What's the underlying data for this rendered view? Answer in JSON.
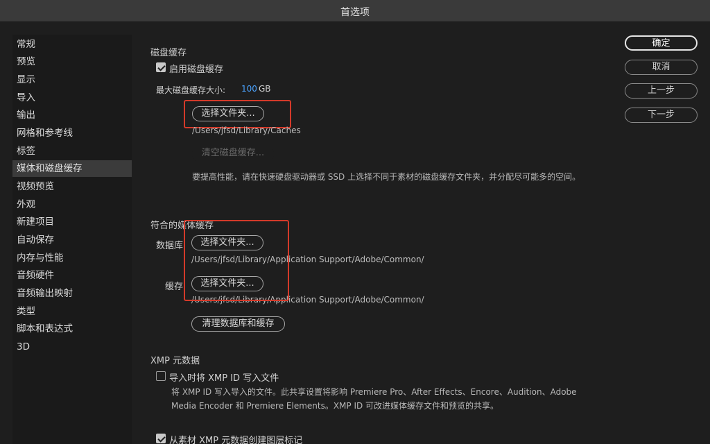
{
  "window": {
    "title": "首选项"
  },
  "sidebar": {
    "items": [
      {
        "label": "常规"
      },
      {
        "label": "预览"
      },
      {
        "label": "显示"
      },
      {
        "label": "导入"
      },
      {
        "label": "输出"
      },
      {
        "label": "网格和参考线"
      },
      {
        "label": "标签"
      },
      {
        "label": "媒体和磁盘缓存",
        "selected": true
      },
      {
        "label": "视频预览"
      },
      {
        "label": "外观"
      },
      {
        "label": "新建项目"
      },
      {
        "label": "自动保存"
      },
      {
        "label": "内存与性能"
      },
      {
        "label": "音频硬件"
      },
      {
        "label": "音频输出映射"
      },
      {
        "label": "类型"
      },
      {
        "label": "脚本和表达式"
      },
      {
        "label": "3D"
      }
    ]
  },
  "disk_cache": {
    "title": "磁盘缓存",
    "enable_label": "启用磁盘缓存",
    "enabled": true,
    "max_size_label": "最大磁盘缓存大小:",
    "max_size_value": "100",
    "max_size_unit": "GB",
    "choose_folder": "选择文件夹...",
    "path": "/Users/jfsd/Library/Caches",
    "clear_button": "清空磁盘缓存...",
    "note": "要提高性能，请在快速硬盘驱动器或 SSD 上选择不同于素材的磁盘缓存文件夹，并分配尽可能多的空间。"
  },
  "conformed_cache": {
    "title": "符合的媒体缓存",
    "database_label": "数据库:",
    "database_choose": "选择文件夹...",
    "database_path": "/Users/jfsd/Library/Application Support/Adobe/Common/",
    "cache_label": "缓存:",
    "cache_choose": "选择文件夹...",
    "cache_path": "/Users/jfsd/Library/Application Support/Adobe/Common/",
    "clear_button": "清理数据库和缓存"
  },
  "xmp": {
    "title": "XMP 元数据",
    "write_on_import_label": "导入时将 XMP ID 写入文件",
    "write_on_import": false,
    "note": "将 XMP ID 写入导入的文件。此共享设置将影响 Premiere Pro、After Effects、Encore、Audition、Adobe Media Encoder 和 Premiere Elements。XMP ID 可改进媒体缓存文件和预览的共享。",
    "create_markers_label": "从素材 XMP 元数据创建图层标记",
    "create_markers": true
  },
  "buttons": {
    "ok": "确定",
    "cancel": "取消",
    "prev": "上一步",
    "next": "下一步"
  }
}
